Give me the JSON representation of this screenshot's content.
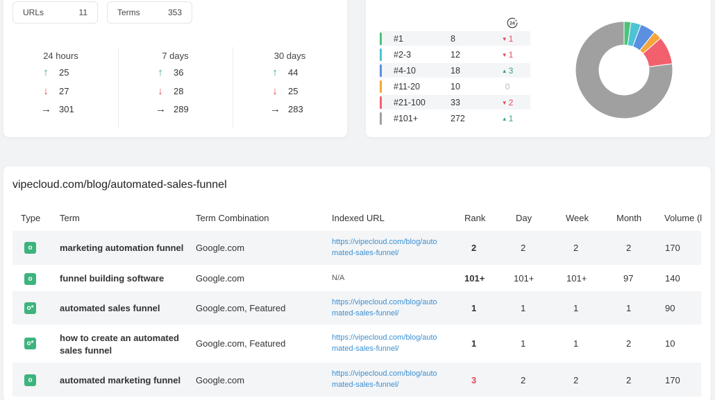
{
  "summary": {
    "urls_label": "URLs",
    "urls_value": "11",
    "terms_label": "Terms",
    "terms_value": "353",
    "periods": [
      {
        "title": "24 hours",
        "up": "25",
        "down": "27",
        "same": "301"
      },
      {
        "title": "7 days",
        "up": "36",
        "down": "28",
        "same": "289"
      },
      {
        "title": "30 days",
        "up": "44",
        "down": "25",
        "same": "283"
      }
    ]
  },
  "distribution": {
    "clock_label": "24",
    "rows": [
      {
        "label": "#1",
        "count": "8",
        "change": "1",
        "dir": "down",
        "color": "#4cc27a"
      },
      {
        "label": "#2-3",
        "count": "12",
        "change": "1",
        "dir": "down",
        "color": "#4ec3d5"
      },
      {
        "label": "#4-10",
        "count": "18",
        "change": "3",
        "dir": "up",
        "color": "#5b8fe0"
      },
      {
        "label": "#11-20",
        "count": "10",
        "change": "0",
        "dir": "zero",
        "color": "#f6a53b"
      },
      {
        "label": "#21-100",
        "count": "33",
        "change": "2",
        "dir": "down",
        "color": "#f2606e"
      },
      {
        "label": "#101+",
        "count": "272",
        "change": "1",
        "dir": "up",
        "color": "#a0a0a0"
      }
    ]
  },
  "chart_data": {
    "type": "pie",
    "categories": [
      "#1",
      "#2-3",
      "#4-10",
      "#11-20",
      "#21-100",
      "#101+"
    ],
    "values": [
      8,
      12,
      18,
      10,
      33,
      272
    ],
    "colors": [
      "#4cc27a",
      "#4ec3d5",
      "#5b8fe0",
      "#f6a53b",
      "#f2606e",
      "#a0a0a0"
    ],
    "donut": true
  },
  "table": {
    "title": "vipecloud.com/blog/automated-sales-funnel",
    "headers": {
      "type": "Type",
      "term": "Term",
      "combo": "Term Combination",
      "url": "Indexed URL",
      "rank": "Rank",
      "day": "Day",
      "week": "Week",
      "month": "Month",
      "volume": "Volume (l"
    },
    "rows": [
      {
        "icon": "o",
        "term": "marketing automation funnel",
        "combo": "Google.com",
        "url1": "https://vipecloud.com/blog/auto",
        "url2": "mated-sales-funnel/",
        "rank": "2",
        "day": "2",
        "week": "2",
        "month": "2",
        "volume": "170"
      },
      {
        "icon": "o",
        "term": "funnel building software",
        "combo": "Google.com",
        "url1": "N/A",
        "url2": "",
        "rank": "101+",
        "day": "101+",
        "week": "101+",
        "month": "97",
        "volume": "140"
      },
      {
        "icon": "o*",
        "term": "automated sales funnel",
        "combo": "Google.com, Featured",
        "url1": "https://vipecloud.com/blog/auto",
        "url2": "mated-sales-funnel/",
        "rank": "1",
        "day": "1",
        "week": "1",
        "month": "1",
        "volume": "90"
      },
      {
        "icon": "o*",
        "term1": "how to create an automated",
        "term2": "sales funnel",
        "combo": "Google.com, Featured",
        "url1": "https://vipecloud.com/blog/auto",
        "url2": "mated-sales-funnel/",
        "rank": "1",
        "day": "1",
        "week": "1",
        "month": "2",
        "volume": "10"
      },
      {
        "icon": "o",
        "term": "automated marketing funnel",
        "combo": "Google.com",
        "url1": "https://vipecloud.com/blog/auto",
        "url2": "mated-sales-funnel/",
        "rank": "3",
        "day": "2",
        "week": "2",
        "month": "2",
        "volume": "170"
      }
    ]
  }
}
